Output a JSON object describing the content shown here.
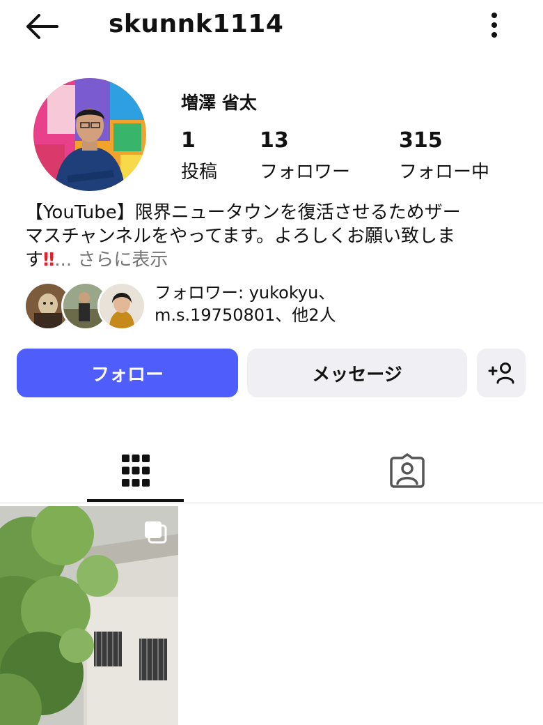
{
  "header": {
    "username": "skunnk1114",
    "back_icon": "arrow-left-icon",
    "more_icon": "vertical-dots-icon"
  },
  "profile": {
    "display_name": "増澤 省太",
    "stats": [
      {
        "number": "1",
        "label": "投稿"
      },
      {
        "number": "13",
        "label": "フォロワー"
      },
      {
        "number": "315",
        "label": "フォロー中"
      }
    ],
    "bio_line1": "【YouTube】限界ニュータウンを復活させるためザー",
    "bio_line2": "マスチャンネルをやってます。よろしくお願い致しま",
    "bio_line3": "す",
    "bio_emoji": "‼",
    "bio_more": "... さらに表示"
  },
  "mutual": {
    "line1": "フォロワー: yukokyu、",
    "line2": "m.s.19750801、他2人"
  },
  "actions": {
    "follow": "フォロー",
    "message": "メッセージ",
    "suggest_icon": "add-person-icon"
  },
  "tabs": {
    "posts_icon": "grid-icon",
    "tagged_icon": "tagged-person-icon"
  },
  "colors": {
    "accent": "#4f5dfb",
    "secondary_button": "#efeff4",
    "muted_text": "#737373"
  }
}
